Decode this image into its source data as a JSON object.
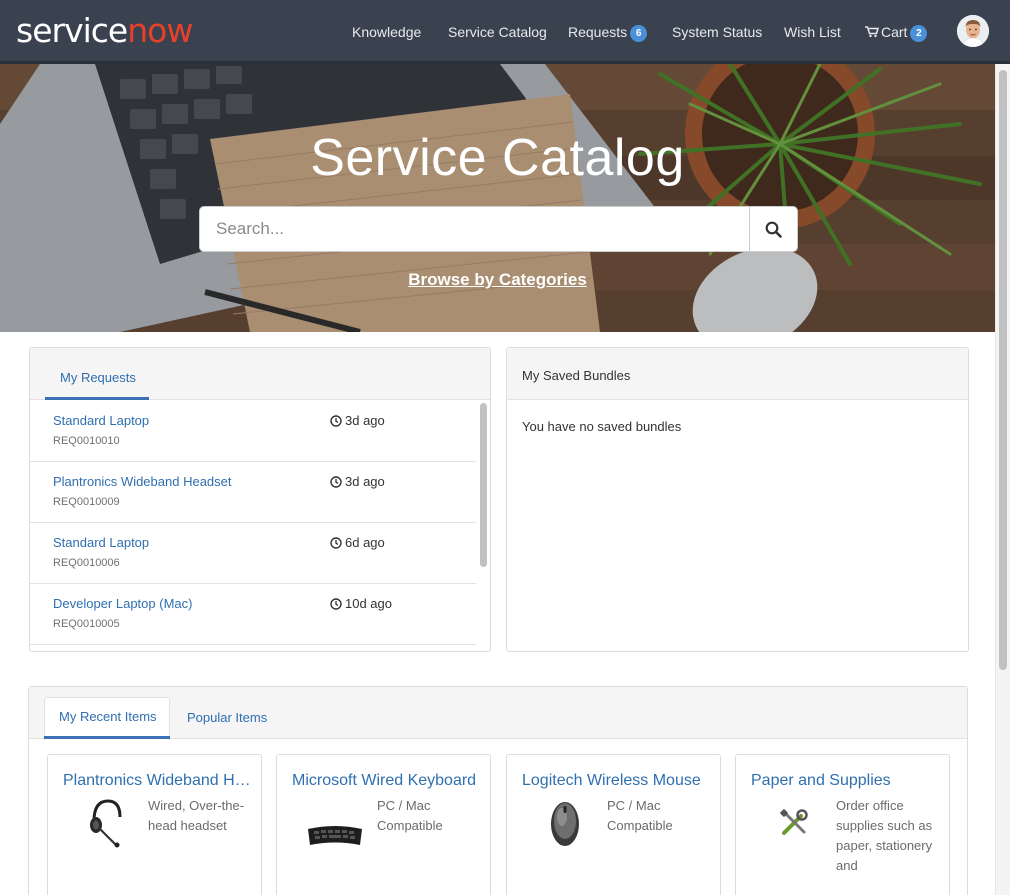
{
  "brand": {
    "logo_service": "service",
    "logo_now": "now"
  },
  "nav": {
    "knowledge": "Knowledge",
    "service_catalog": "Service Catalog",
    "requests": "Requests",
    "requests_count": "6",
    "system_status": "System Status",
    "wish_list": "Wish List",
    "cart": "Cart",
    "cart_count": "2"
  },
  "hero": {
    "title": "Service Catalog",
    "search_placeholder": "Search...",
    "browse_link": "Browse by Categories"
  },
  "my_requests": {
    "tab": "My Requests",
    "items": [
      {
        "name": "Standard Laptop",
        "number": "REQ0010010",
        "time": "3d ago"
      },
      {
        "name": "Plantronics Wideband Headset",
        "number": "REQ0010009",
        "time": "3d ago"
      },
      {
        "name": "Standard Laptop",
        "number": "REQ0010006",
        "time": "6d ago"
      },
      {
        "name": "Developer Laptop (Mac)",
        "number": "REQ0010005",
        "time": "10d ago"
      }
    ]
  },
  "saved_bundles": {
    "title": "My Saved Bundles",
    "empty_text": "You have no saved bundles"
  },
  "items_panel": {
    "tab_recent": "My Recent Items",
    "tab_popular": "Popular Items",
    "cards": [
      {
        "title": "Plantronics Wideband Headset",
        "desc": "Wired, Over-the-head headset",
        "icon": "headset-icon"
      },
      {
        "title": "Microsoft Wired Keyboard",
        "desc": "PC / Mac Compatible",
        "icon": "keyboard-icon"
      },
      {
        "title": "Logitech Wireless Mouse",
        "desc": "PC / Mac Compatible",
        "icon": "mouse-icon"
      },
      {
        "title": "Paper and Supplies",
        "desc": "Order office supplies such as paper, stationery and",
        "icon": "tools-icon"
      }
    ]
  },
  "colors": {
    "header": "#3a4250",
    "link": "#2f6fb0",
    "badge": "#4a90d9",
    "logo_accent": "#e8402a"
  }
}
